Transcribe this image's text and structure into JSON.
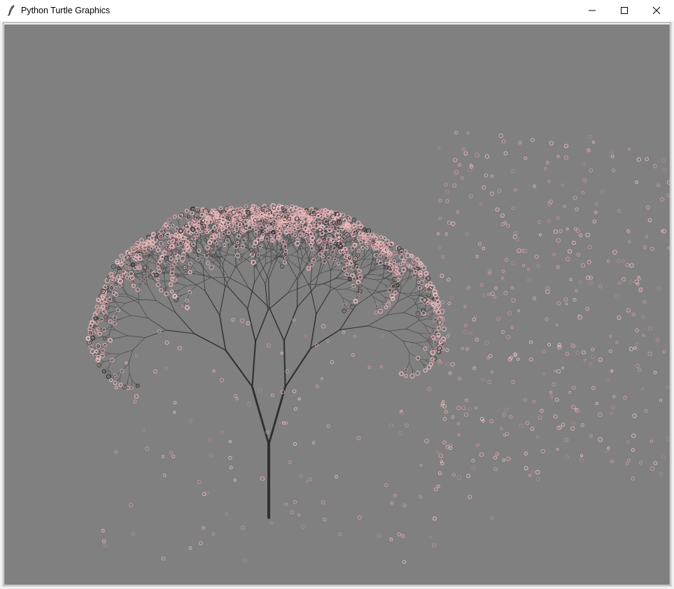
{
  "window": {
    "title": "Python Turtle Graphics",
    "app_icon": "feather-pen-icon",
    "controls": {
      "minimize_icon": "minimize-icon",
      "maximize_icon": "maximize-icon",
      "close_icon": "close-icon"
    }
  },
  "canvas": {
    "background_color": "#808080",
    "branch_color": "#333333",
    "blossom_color": "#e8b4b8"
  }
}
